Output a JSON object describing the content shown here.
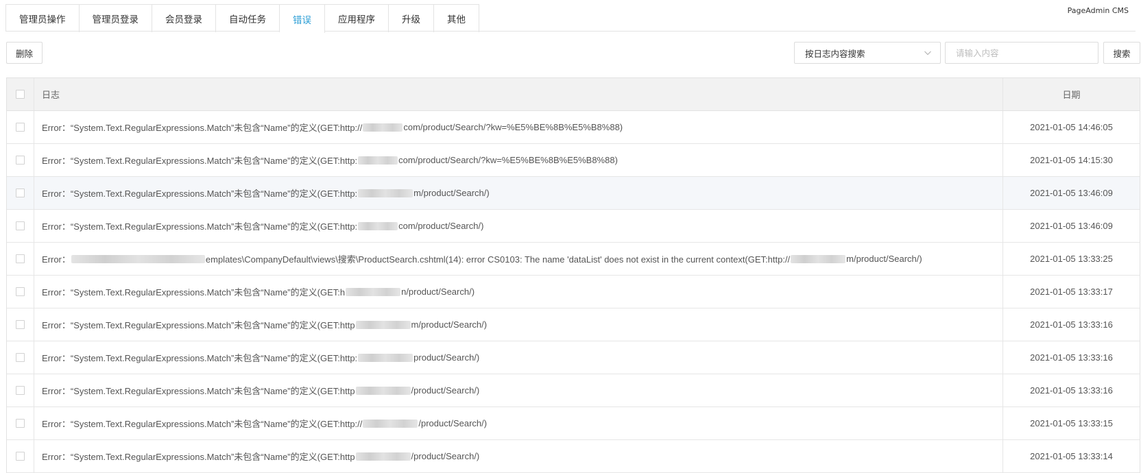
{
  "brand": "PageAdmin CMS",
  "tabs": [
    {
      "label": "管理员操作",
      "active": false
    },
    {
      "label": "管理员登录",
      "active": false
    },
    {
      "label": "会员登录",
      "active": false
    },
    {
      "label": "自动任务",
      "active": false
    },
    {
      "label": "错误",
      "active": true
    },
    {
      "label": "应用程序",
      "active": false
    },
    {
      "label": "升级",
      "active": false
    },
    {
      "label": "其他",
      "active": false
    }
  ],
  "toolbar": {
    "delete_label": "删除",
    "search_type": "按日志内容搜索",
    "search_placeholder": "请输入内容",
    "search_label": "搜索"
  },
  "table": {
    "headers": {
      "log": "日志",
      "date": "日期"
    },
    "rows": [
      {
        "prefix": "Error：“System.Text.RegularExpressions.Match”未包含“Name”的定义(GET:http://",
        "suffix": "com/product/Search/?kw=%E5%BE%8B%E5%B8%88)",
        "date": "2021-01-05 14:46:05"
      },
      {
        "prefix": "Error：“System.Text.RegularExpressions.Match”未包含“Name”的定义(GET:http:",
        "suffix": "com/product/Search/?kw=%E5%BE%8B%E5%B8%88)",
        "date": "2021-01-05 14:15:30"
      },
      {
        "prefix": "Error：“System.Text.RegularExpressions.Match”未包含“Name”的定义(GET:http:",
        "suffix": "m/product/Search/)",
        "date": "2021-01-05 13:46:09"
      },
      {
        "prefix": "Error：“System.Text.RegularExpressions.Match”未包含“Name”的定义(GET:http:",
        "suffix": "com/product/Search/)",
        "date": "2021-01-05 13:46:09"
      },
      {
        "prefix": "Error：",
        "suffix": "emplates\\CompanyDefault\\views\\搜索\\ProductSearch.cshtml(14): error CS0103: The name 'dataList' does not exist in the current context(GET:http://",
        "suffix2": "m/product/Search/)",
        "date": "2021-01-05 13:33:25"
      },
      {
        "prefix": "Error：“System.Text.RegularExpressions.Match”未包含“Name”的定义(GET:h",
        "suffix": "n/product/Search/)",
        "date": "2021-01-05 13:33:17"
      },
      {
        "prefix": "Error：“System.Text.RegularExpressions.Match”未包含“Name”的定义(GET:http",
        "suffix": "m/product/Search/)",
        "date": "2021-01-05 13:33:16"
      },
      {
        "prefix": "Error：“System.Text.RegularExpressions.Match”未包含“Name”的定义(GET:http:",
        "suffix": "product/Search/)",
        "date": "2021-01-05 13:33:16"
      },
      {
        "prefix": "Error：“System.Text.RegularExpressions.Match”未包含“Name”的定义(GET:http",
        "suffix": "/product/Search/)",
        "date": "2021-01-05 13:33:16"
      },
      {
        "prefix": "Error：“System.Text.RegularExpressions.Match”未包含“Name”的定义(GET:http://",
        "suffix": "/product/Search/)",
        "date": "2021-01-05 13:33:15"
      },
      {
        "prefix": "Error：“System.Text.RegularExpressions.Match”未包含“Name”的定义(GET:http",
        "suffix": "/product/Search/)",
        "date": "2021-01-05 13:33:14"
      }
    ]
  }
}
